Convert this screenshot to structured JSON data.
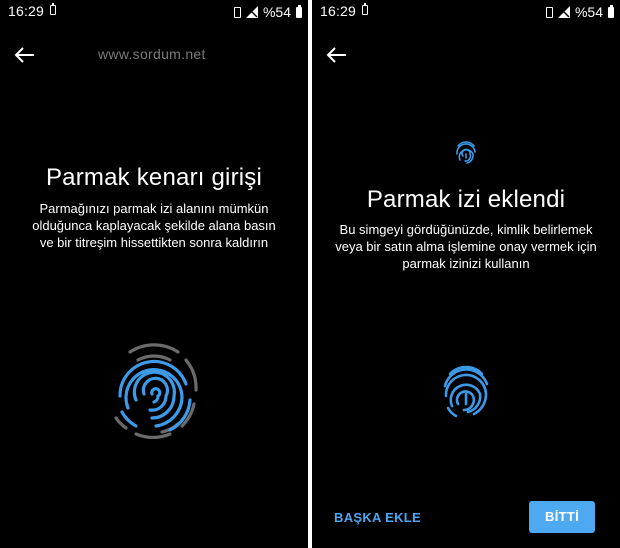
{
  "status_bar": {
    "time": "16:29",
    "battery_percent": "%54"
  },
  "left_screen": {
    "watermark": "www.sordum.net",
    "title": "Parmak kenarı girişi",
    "description": "Parmağınızı parmak izi alanını mümkün olduğunca kaplayacak şekilde alana basın ve bir titreşim hissettikten sonra kaldırın"
  },
  "right_screen": {
    "title": "Parmak izi eklendi",
    "description": "Bu simgeyi gördüğünüzde, kimlik belirlemek veya bir satın alma işlemine onay vermek için parmak izinizi kullanın",
    "secondary_button": "BAŞKA EKLE",
    "primary_button": "BİTTİ"
  },
  "colors": {
    "accent": "#4ea9f0",
    "fingerprint_blue": "#3b9be8",
    "fingerprint_gray": "#6b6b6b",
    "background": "#000000"
  }
}
